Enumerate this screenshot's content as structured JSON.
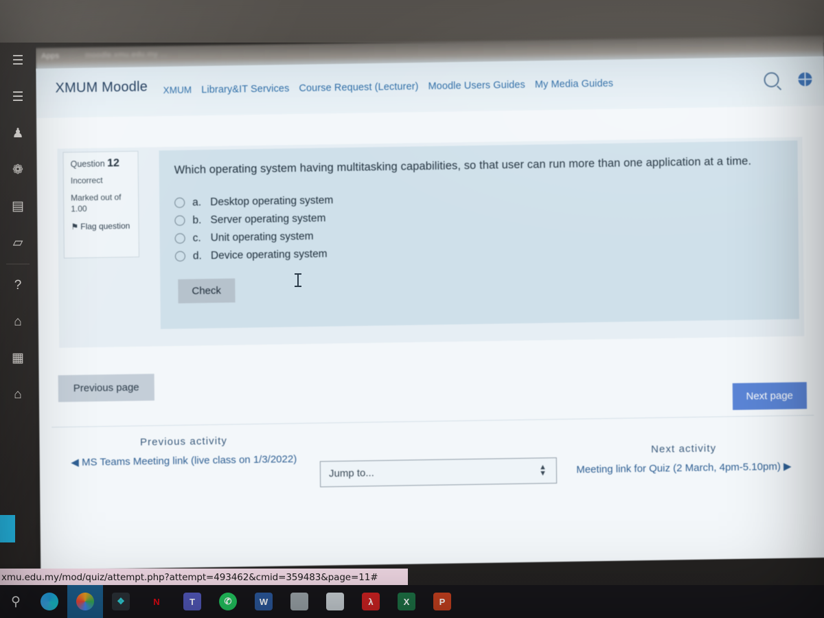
{
  "browser": {
    "bookmark_apps_label": "Apps",
    "bookmark_blur_text": "moodle.xmu.edu.my ..."
  },
  "header": {
    "brand": "XMUM Moodle",
    "nav": [
      {
        "label": "XMUM",
        "name": "nav-xmum"
      },
      {
        "label": "Library&IT Services",
        "name": "nav-library-it-services"
      },
      {
        "label": "Course Request (Lecturer)",
        "name": "nav-course-request-lecturer"
      },
      {
        "label": "Moodle Users Guides",
        "name": "nav-moodle-users-guides"
      },
      {
        "label": "My Media Guides",
        "name": "nav-my-media-guides"
      }
    ],
    "icons": {
      "search": "search-icon",
      "language": "globe-icon"
    }
  },
  "sidebar": {
    "items": [
      {
        "name": "sidebar-menu-toggle",
        "glyph": "☰"
      },
      {
        "name": "sidebar-item-list",
        "glyph": "☰"
      },
      {
        "name": "sidebar-item-participants",
        "glyph": "♟"
      },
      {
        "name": "sidebar-item-badges",
        "glyph": "❁"
      },
      {
        "name": "sidebar-item-book",
        "glyph": "▤"
      },
      {
        "name": "sidebar-item-files",
        "glyph": "▱"
      },
      {
        "name": "sidebar-item-help",
        "glyph": "?"
      },
      {
        "name": "sidebar-item-home",
        "glyph": "⌂"
      },
      {
        "name": "sidebar-item-calendar",
        "glyph": "▦"
      },
      {
        "name": "sidebar-item-dashboard",
        "glyph": "⌂"
      }
    ]
  },
  "question": {
    "number_label": "Question",
    "number": "12",
    "state": "Incorrect",
    "marked_out_of_label": "Marked out of",
    "marked_out_of_value": "1.00",
    "flag_label": "Flag question",
    "flag_icon": "flag-icon",
    "text": "Which operating system having multitasking capabilities, so that user can run more than one application at a time.",
    "options": [
      {
        "key": "a.",
        "label": "Desktop operating system",
        "selected": false
      },
      {
        "key": "b.",
        "label": "Server operating system",
        "selected": false
      },
      {
        "key": "c.",
        "label": "Unit operating system",
        "selected": false
      },
      {
        "key": "d.",
        "label": "Device operating system",
        "selected": false
      }
    ],
    "check_button": "Check"
  },
  "pagination": {
    "previous_page": "Previous page",
    "next_page": "Next page",
    "next_page_color": "#5b85d6"
  },
  "activity_nav": {
    "previous_label": "Previous activity",
    "previous_link": "MS Teams Meeting link (live class on 1/3/2022)",
    "previous_arrow": "◀",
    "next_label": "Next activity",
    "next_link": "Meeting link for Quiz (2 March, 4pm-5.10pm)",
    "next_arrow": "▶",
    "jump_to": "Jump to..."
  },
  "status_bar": {
    "url": "xmu.edu.my/mod/quiz/attempt.php?attempt=493462&cmid=359483&page=11#"
  },
  "taskbar": {
    "search_icon": "search-icon",
    "items": [
      {
        "name": "taskbar-edge",
        "label": "",
        "color": "#1d9ad6",
        "active": false
      },
      {
        "name": "taskbar-chrome",
        "label": "",
        "color": "#e8a020",
        "active": true
      },
      {
        "name": "taskbar-teal-app",
        "label": "❖",
        "color": "#1f9aa0",
        "active": false
      },
      {
        "name": "taskbar-netflix",
        "label": "N",
        "color": "#2a1114",
        "active": false
      },
      {
        "name": "taskbar-teams",
        "label": "T",
        "color": "#5157b8",
        "active": false
      },
      {
        "name": "taskbar-whatsapp",
        "label": "✆",
        "color": "#22c35e",
        "active": false
      },
      {
        "name": "taskbar-word",
        "label": "W",
        "color": "#2b579a",
        "active": false
      },
      {
        "name": "taskbar-app-grey",
        "label": "",
        "color": "#9aa3a8",
        "active": false
      },
      {
        "name": "taskbar-app-light",
        "label": "",
        "color": "#c8cfd4",
        "active": false
      },
      {
        "name": "taskbar-acrobat",
        "label": "λ",
        "color": "#cc2222",
        "active": false
      },
      {
        "name": "taskbar-excel",
        "label": "X",
        "color": "#1d7044",
        "active": false
      },
      {
        "name": "taskbar-powerpoint",
        "label": "P",
        "color": "#c4401f",
        "active": false
      }
    ]
  }
}
